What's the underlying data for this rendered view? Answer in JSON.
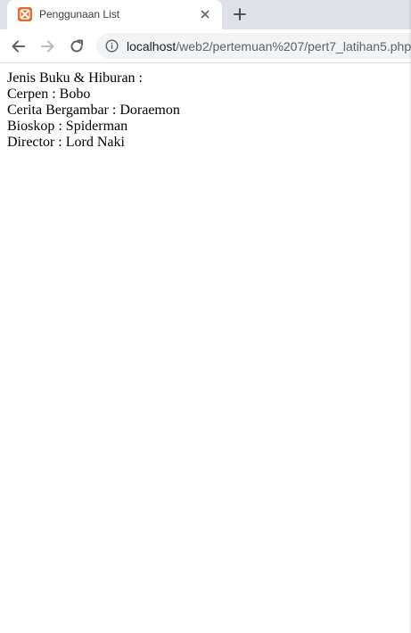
{
  "browser": {
    "tab": {
      "title": "Penggunaan List",
      "favicon": "xampp-icon"
    },
    "new_tab_icon": "plus-icon",
    "address": {
      "host": "localhost",
      "path": "/web2/pertemuan%207/pert7_latihan5.php"
    },
    "colors": {
      "tab_strip": "#dee1e6",
      "favicon": "#e56a2b",
      "omnibox": "#f1f3f4"
    }
  },
  "page": {
    "heading": "Jenis Buku & Hiburan :",
    "lines": [
      "Cerpen : Bobo",
      "Cerita Bergambar : Doraemon",
      "Bioskop : Spiderman",
      "Director : Lord Naki"
    ]
  }
}
